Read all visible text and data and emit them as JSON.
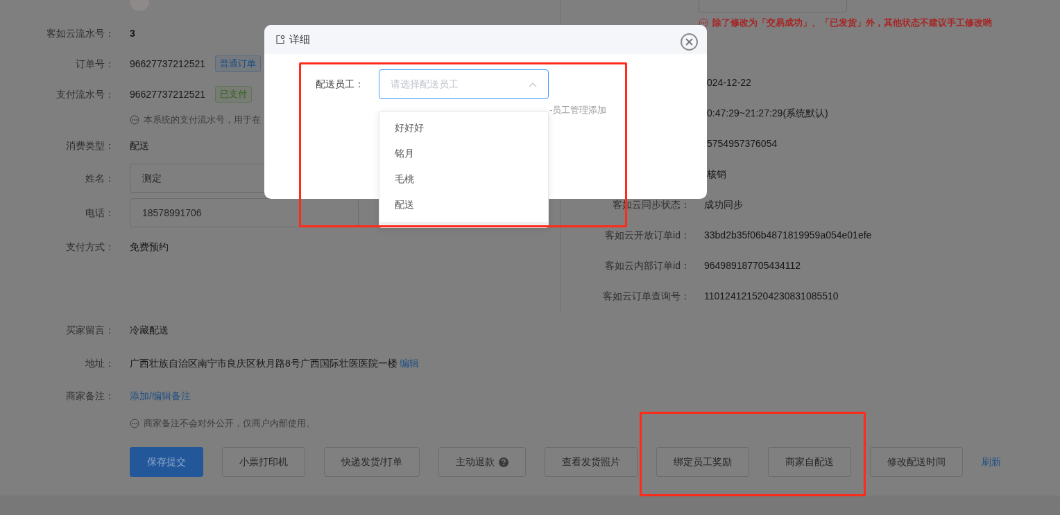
{
  "left_rows": [
    {
      "kind": "user"
    },
    {
      "kind": "bold",
      "label": "客如云流水号：",
      "value": "3"
    },
    {
      "kind": "tagged",
      "label": "订单号：",
      "value": "96627737212521",
      "tag": {
        "text": "普通订单",
        "color": "#204f80"
      }
    },
    {
      "kind": "tagged",
      "label": "支付流水号：",
      "value": "96627737212521",
      "tag": {
        "text": "已支付",
        "color": "#33611d"
      }
    },
    {
      "kind": "hint",
      "value": "本系统的支付流水号，用于在"
    },
    {
      "kind": "text",
      "label": "消费类型：",
      "value": "配送"
    },
    {
      "kind": "input",
      "label": "姓名：",
      "value": "测定"
    },
    {
      "kind": "input",
      "label": "电话：",
      "value": "18578991706"
    },
    {
      "kind": "text",
      "label": "支付方式：",
      "value": "免费预约"
    }
  ],
  "status_warning": "除了修改为「交易成功」、「已发货」外，其他状态不建议手工修改哟",
  "right_rows": [
    {
      "value": "024-12-22"
    },
    {
      "value": "0:47:29~21:27:29(系统默认)"
    },
    {
      "value": "5754957376054"
    },
    {
      "value": "核销"
    },
    {
      "label": "客如云同步状态：",
      "value": "成功同步"
    },
    {
      "label": "客如云开放订单id：",
      "value": "33bd2b35f06b4871819959a054e01efe"
    },
    {
      "label": "客如云内部订单id：",
      "value": "964989187705434112"
    },
    {
      "label": "客如云订单查询号：",
      "value": "1101241215204230831085510"
    }
  ],
  "bottom_rows": [
    {
      "kind": "text",
      "label": "买家留言：",
      "value": "冷藏配送"
    },
    {
      "kind": "text_link",
      "label": "地址：",
      "value": "广西壮族自治区南宁市良庆区秋月路8号广西国际壮医医院一楼",
      "link": "编辑"
    },
    {
      "kind": "link",
      "label": "商家备注：",
      "value": "添加/编辑备注"
    },
    {
      "kind": "hint",
      "value": "商家备注不会对外公开，仅商户内部使用。"
    }
  ],
  "buttons": [
    {
      "label": "保存提交",
      "kind": "primary"
    },
    {
      "label": "小票打印机",
      "kind": "default"
    },
    {
      "label": "快递发货/打单",
      "kind": "default"
    },
    {
      "label": "主动退款",
      "kind": "help"
    },
    {
      "label": "查看发货照片",
      "kind": "default"
    },
    {
      "label": "绑定员工奖励",
      "kind": "default"
    },
    {
      "label": "商家自配送",
      "kind": "default"
    },
    {
      "label": "修改配送时间",
      "kind": "default"
    },
    {
      "label": "刷新",
      "kind": "link"
    }
  ],
  "dialog": {
    "title": "详细",
    "field_label": "配送员工：",
    "placeholder": "请选择配送员工",
    "expanded": true,
    "hint": "-员工管理添加",
    "options": [
      {
        "label": "好好好",
        "selected": false
      },
      {
        "label": "铭月",
        "selected": false
      },
      {
        "label": "毛桃",
        "selected": false
      },
      {
        "label": "配送",
        "selected": false
      }
    ]
  }
}
